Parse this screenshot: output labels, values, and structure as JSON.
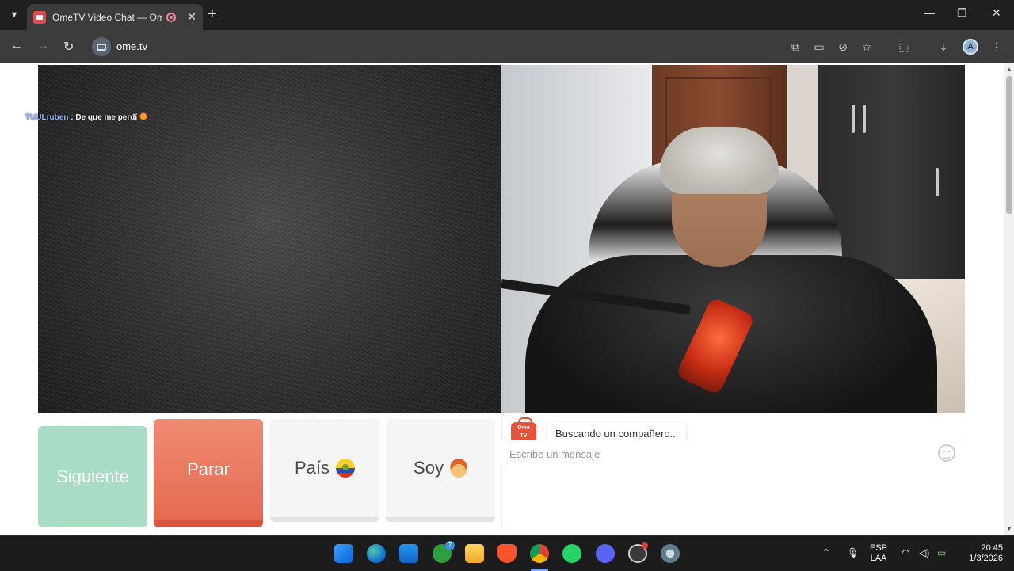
{
  "browser": {
    "tab_title": "OmeTV Video Chat — Ome",
    "tab_close": "✕",
    "new_tab": "+",
    "url": "ome.tv",
    "window_controls": {
      "minimize": "—",
      "maximize": "❐",
      "close": "✕"
    }
  },
  "video": {
    "overlay_user": "TUULruben",
    "overlay_text": " : De que me perdí"
  },
  "buttons": {
    "next": "Siguiente",
    "stop": "Parar",
    "country": "País",
    "soy": "Soy"
  },
  "chat": {
    "logo_line1": "Ome",
    "logo_line2": "TV",
    "status_message": "Buscando un compañero...",
    "input_placeholder": "Escribe un mensaje"
  },
  "taskbar": {
    "lang_line1": "ESP",
    "lang_line2": "LAA",
    "time": "20:45",
    "date": "1/3/2026",
    "badge_count": "7"
  },
  "colors": {
    "next_button": "#a8dcc5",
    "stop_button": "#e46c52",
    "brand": "#e6533c"
  }
}
